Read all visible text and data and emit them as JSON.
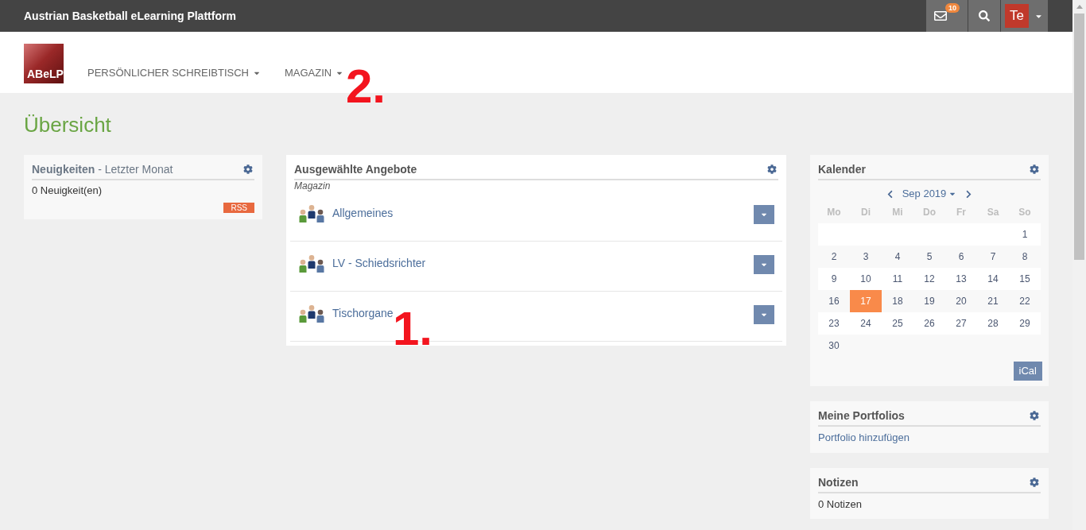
{
  "top_bar": {
    "title": "Austrian Basketball eLearning Plattform",
    "messages_badge": "10",
    "avatar": "Te"
  },
  "nav": {
    "logo": "ABeLP",
    "items": [
      {
        "label": "PERSÖNLICHER SCHREIBTISCH"
      },
      {
        "label": "MAGAZIN"
      }
    ]
  },
  "page_title": "Übersicht",
  "news": {
    "title": "**Neuigkeiten** - Letzter Monat",
    "count": "0 Neuigkeit(en)",
    "rss": "RSS"
  },
  "offers": {
    "title": "Ausgewählte Angebote",
    "category": "Magazin",
    "items": [
      {
        "label": "Allgemeines"
      },
      {
        "label": "LV - Schiedsrichter"
      },
      {
        "label": "Tischorgane"
      }
    ]
  },
  "calendar": {
    "title": "Kalender",
    "month": "Sep 2019",
    "weekdays": [
      "Mo",
      "Di",
      "Mi",
      "Do",
      "Fr",
      "Sa",
      "So"
    ],
    "weeks": [
      [
        {
          "kind": "blank"
        },
        {
          "kind": "blank"
        },
        {
          "kind": "blank"
        },
        {
          "kind": "blank"
        },
        {
          "kind": "blank"
        },
        {
          "kind": "blank"
        },
        {
          "kind": "day",
          "day": "1",
          "selected": false
        }
      ],
      [
        {
          "kind": "day",
          "day": "2",
          "selected": false
        },
        {
          "kind": "day",
          "day": "3",
          "selected": false
        },
        {
          "kind": "day",
          "day": "4",
          "selected": false
        },
        {
          "kind": "day",
          "day": "5",
          "selected": false
        },
        {
          "kind": "day",
          "day": "6",
          "selected": false
        },
        {
          "kind": "day",
          "day": "7",
          "selected": false
        },
        {
          "kind": "day",
          "day": "8",
          "selected": false
        }
      ],
      [
        {
          "kind": "day",
          "day": "9",
          "selected": false
        },
        {
          "kind": "day",
          "day": "10",
          "selected": false
        },
        {
          "kind": "day",
          "day": "11",
          "selected": false
        },
        {
          "kind": "day",
          "day": "12",
          "selected": false
        },
        {
          "kind": "day",
          "day": "13",
          "selected": false
        },
        {
          "kind": "day",
          "day": "14",
          "selected": false
        },
        {
          "kind": "day",
          "day": "15",
          "selected": false
        }
      ],
      [
        {
          "kind": "day",
          "day": "16",
          "selected": false
        },
        {
          "kind": "day",
          "day": "17",
          "selected": true
        },
        {
          "kind": "day",
          "day": "18",
          "selected": false
        },
        {
          "kind": "day",
          "day": "19",
          "selected": false
        },
        {
          "kind": "day",
          "day": "20",
          "selected": false
        },
        {
          "kind": "day",
          "day": "21",
          "selected": false
        },
        {
          "kind": "day",
          "day": "22",
          "selected": false
        }
      ],
      [
        {
          "kind": "day",
          "day": "23",
          "selected": false
        },
        {
          "kind": "day",
          "day": "24",
          "selected": false
        },
        {
          "kind": "day",
          "day": "25",
          "selected": false
        },
        {
          "kind": "day",
          "day": "26",
          "selected": false
        },
        {
          "kind": "day",
          "day": "27",
          "selected": false
        },
        {
          "kind": "day",
          "day": "28",
          "selected": false
        },
        {
          "kind": "day",
          "day": "29",
          "selected": false
        }
      ],
      [
        {
          "kind": "day",
          "day": "30",
          "selected": false
        }
      ]
    ],
    "ical": "iCal"
  },
  "portfolios": {
    "title": "Meine Portfolios",
    "link": "Portfolio hinzufügen"
  },
  "notes": {
    "title": "Notizen",
    "count": "0 Notizen"
  },
  "annotations": [
    {
      "text": "2."
    },
    {
      "text": "1."
    }
  ]
}
